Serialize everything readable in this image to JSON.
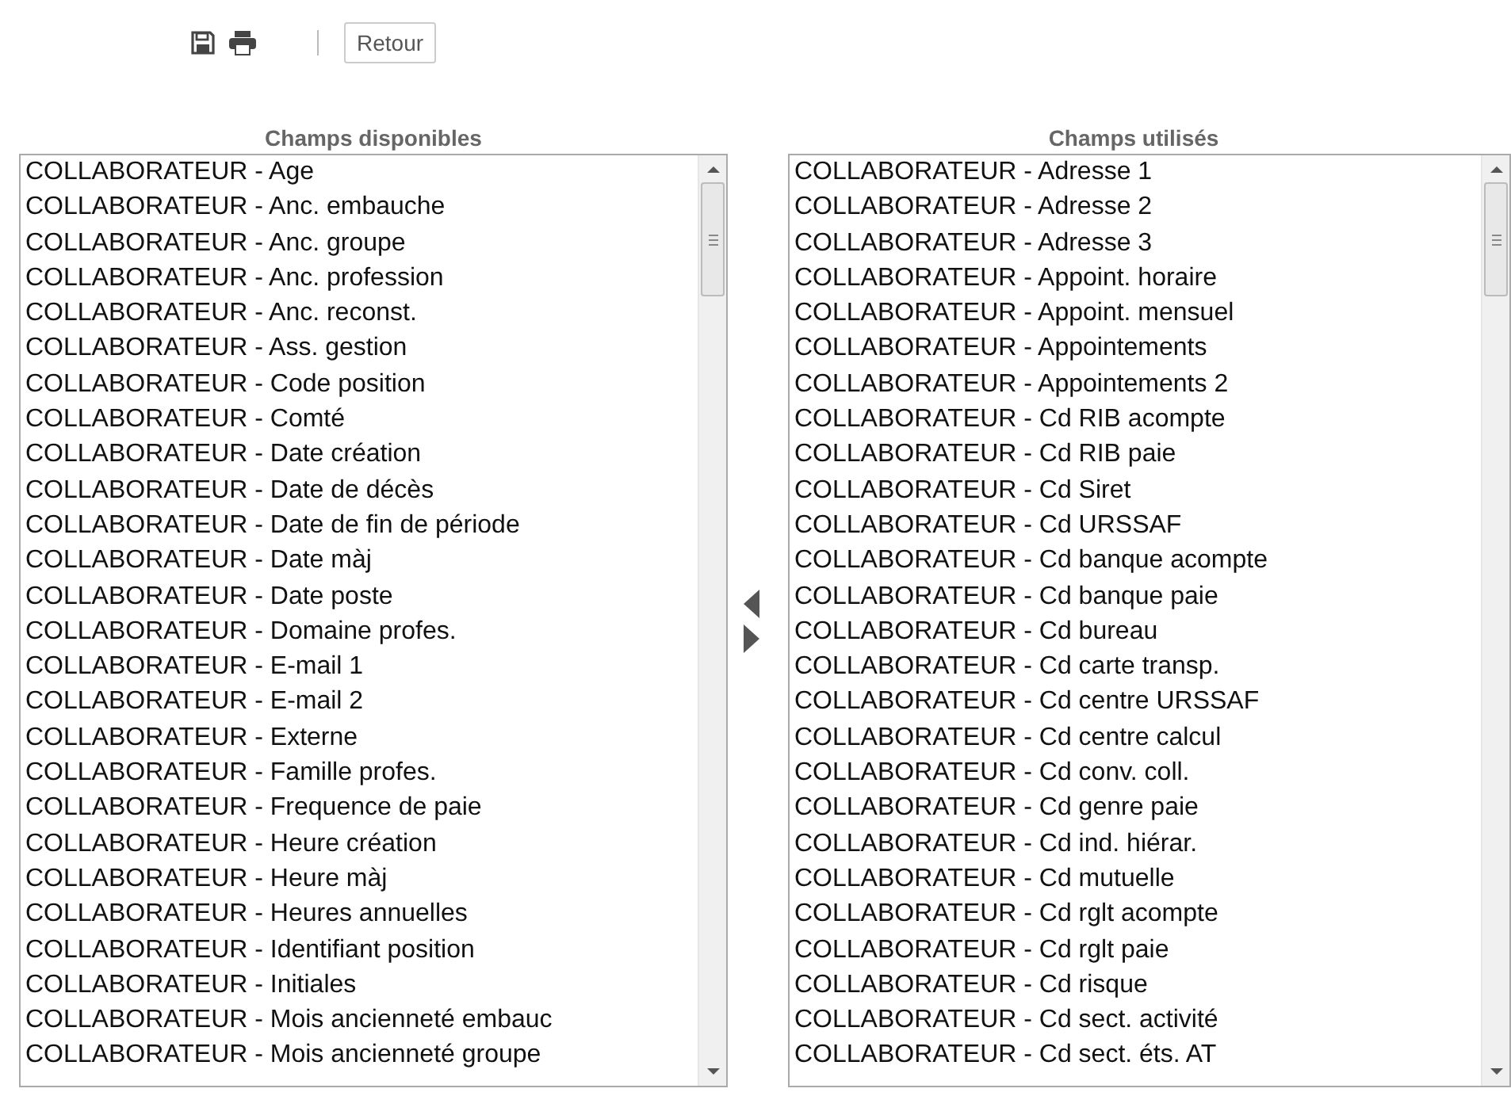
{
  "toolbar": {
    "button": "Retour"
  },
  "lists": [
    {
      "title": "Champs disponibles",
      "items": [
        "COLLABORATEUR - Age",
        "COLLABORATEUR - Anc. embauche",
        "COLLABORATEUR - Anc. groupe",
        "COLLABORATEUR - Anc. profession",
        "COLLABORATEUR - Anc. reconst.",
        "COLLABORATEUR - Ass. gestion",
        "COLLABORATEUR - Code position",
        "COLLABORATEUR - Comté",
        "COLLABORATEUR - Date création",
        "COLLABORATEUR - Date de décès",
        "COLLABORATEUR - Date de fin de période",
        "COLLABORATEUR - Date màj",
        "COLLABORATEUR - Date poste",
        "COLLABORATEUR - Domaine profes.",
        "COLLABORATEUR - E-mail 1",
        "COLLABORATEUR - E-mail 2",
        "COLLABORATEUR - Externe",
        "COLLABORATEUR - Famille profes.",
        "COLLABORATEUR - Frequence de paie",
        "COLLABORATEUR - Heure création",
        "COLLABORATEUR - Heure màj",
        "COLLABORATEUR - Heures annuelles",
        "COLLABORATEUR - Identifiant position",
        "COLLABORATEUR - Initiales",
        "COLLABORATEUR - Mois ancienneté embauc",
        "COLLABORATEUR - Mois ancienneté groupe"
      ]
    },
    {
      "title": "Champs utilisés",
      "items": [
        "COLLABORATEUR - Adresse 1",
        "COLLABORATEUR - Adresse 2",
        "COLLABORATEUR - Adresse 3",
        "COLLABORATEUR - Appoint. horaire",
        "COLLABORATEUR - Appoint. mensuel",
        "COLLABORATEUR - Appointements",
        "COLLABORATEUR - Appointements 2",
        "COLLABORATEUR - Cd RIB acompte",
        "COLLABORATEUR - Cd RIB paie",
        "COLLABORATEUR - Cd Siret",
        "COLLABORATEUR - Cd URSSAF",
        "COLLABORATEUR - Cd banque acompte",
        "COLLABORATEUR - Cd banque paie",
        "COLLABORATEUR - Cd bureau",
        "COLLABORATEUR - Cd carte transp.",
        "COLLABORATEUR - Cd centre URSSAF",
        "COLLABORATEUR - Cd centre calcul",
        "COLLABORATEUR - Cd conv. coll.",
        "COLLABORATEUR - Cd genre paie",
        "COLLABORATEUR - Cd ind. hiérar.",
        "COLLABORATEUR - Cd mutuelle",
        "COLLABORATEUR - Cd rglt acompte",
        "COLLABORATEUR - Cd rglt paie",
        "COLLABORATEUR - Cd risque",
        "COLLABORATEUR - Cd sect. activité",
        "COLLABORATEUR - Cd sect. éts. AT"
      ]
    }
  ]
}
